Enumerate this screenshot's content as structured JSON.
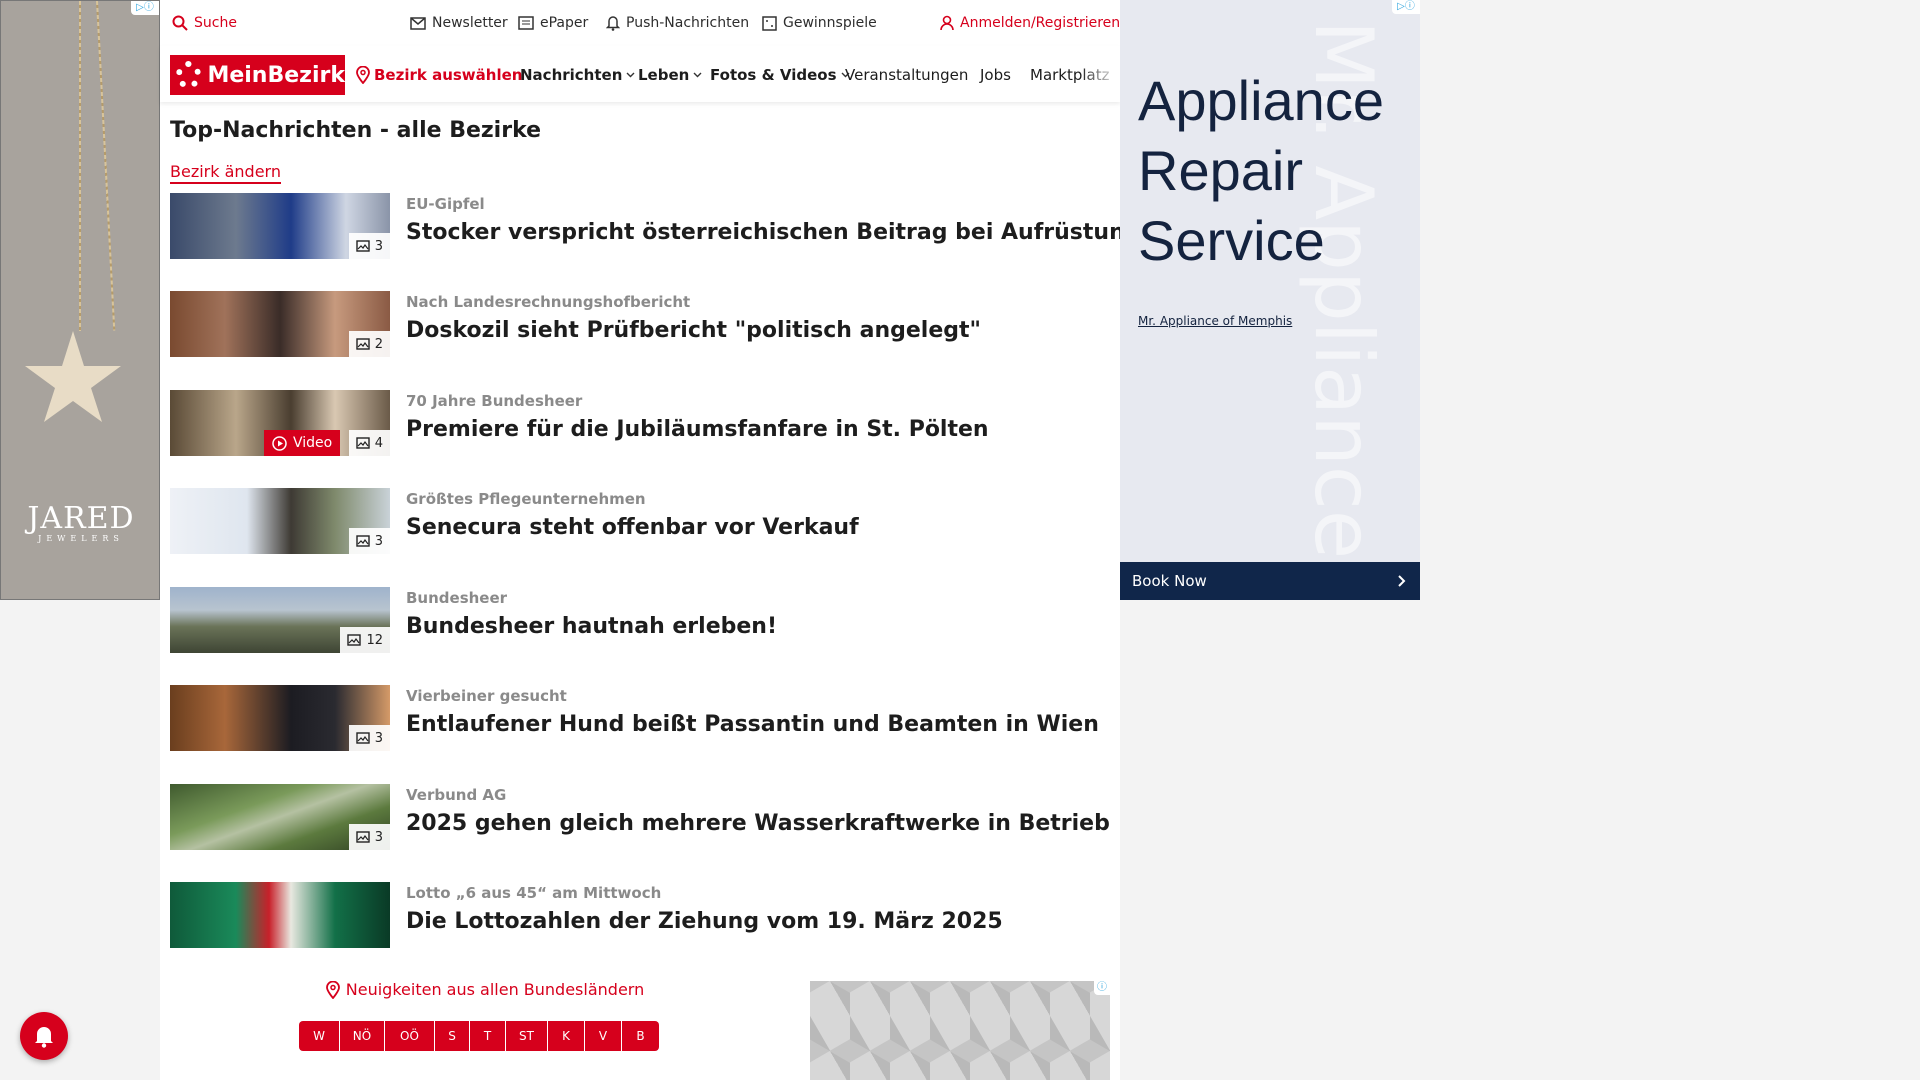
{
  "ad_left": {
    "brand": "JARED",
    "brand_sub": "JEWELERS",
    "adchoice": "▷ⓘ"
  },
  "topbar": {
    "search": "Suche",
    "newsletter": "Newsletter",
    "epaper": "ePaper",
    "push": "Push-Nachrichten",
    "games": "Gewinnspiele",
    "login": "Anmelden/Registrieren"
  },
  "nav": {
    "logo": "MeinBezirk",
    "district": "Bezirk auswählen",
    "items": [
      "Nachrichten",
      "Leben",
      "Fotos & Videos",
      "Veranstaltungen",
      "Jobs",
      "Marktplatz"
    ]
  },
  "page": {
    "title": "Top-Nachrichten - alle Bezirke",
    "change_link": "Bezirk ändern"
  },
  "articles": [
    {
      "kicker": "EU-Gipfel",
      "headline": "Stocker verspricht österreichischen Beitrag bei Aufrüstung",
      "photos": "3",
      "video": ""
    },
    {
      "kicker": "Nach Landesrechnungshofbericht",
      "headline": "Doskozil sieht Prüfbericht \"politisch angelegt\"",
      "photos": "2",
      "video": ""
    },
    {
      "kicker": "70 Jahre Bundesheer",
      "headline": "Premiere für die Jubiläumsfanfare in St. Pölten",
      "photos": "4",
      "video": "Video"
    },
    {
      "kicker": "Größtes Pflegeunternehmen",
      "headline": "Senecura steht offenbar vor Verkauf",
      "photos": "3",
      "video": ""
    },
    {
      "kicker": "Bundesheer",
      "headline": "Bundesheer hautnah erleben!",
      "photos": "12",
      "video": ""
    },
    {
      "kicker": "Vierbeiner gesucht",
      "headline": "Entlaufener Hund beißt Passantin und Beamten in Wien",
      "photos": "3",
      "video": ""
    },
    {
      "kicker": "Verbund AG",
      "headline": "2025 gehen gleich mehrere Wasserkraftwerke in Betrieb",
      "photos": "3",
      "video": ""
    },
    {
      "kicker": "Lotto „6 aus 45“ am Mittwoch",
      "headline": "Die Lottozahlen der Ziehung vom 19. März 2025",
      "photos": "",
      "video": ""
    }
  ],
  "regions": {
    "title": "Neuigkeiten aus allen Bundesländern",
    "items": [
      "W",
      "NÖ",
      "OÖ",
      "S",
      "T",
      "ST",
      "K",
      "V",
      "B"
    ]
  },
  "ad_right": {
    "headline": "Appliance Repair Service",
    "bg_text": "Mr. Appliance of",
    "sponsor": "Mr. Appliance of Memphis",
    "cta": "Book Now"
  },
  "colors": {
    "accent": "#d6001c",
    "ad_navy": "#10264a"
  },
  "icons": [
    "search-icon",
    "mail-icon",
    "newspaper-icon",
    "bell-icon",
    "gift-icon",
    "user-icon",
    "location-pin-icon",
    "chevron-down-icon",
    "image-icon",
    "play-icon",
    "chevron-right-icon"
  ]
}
